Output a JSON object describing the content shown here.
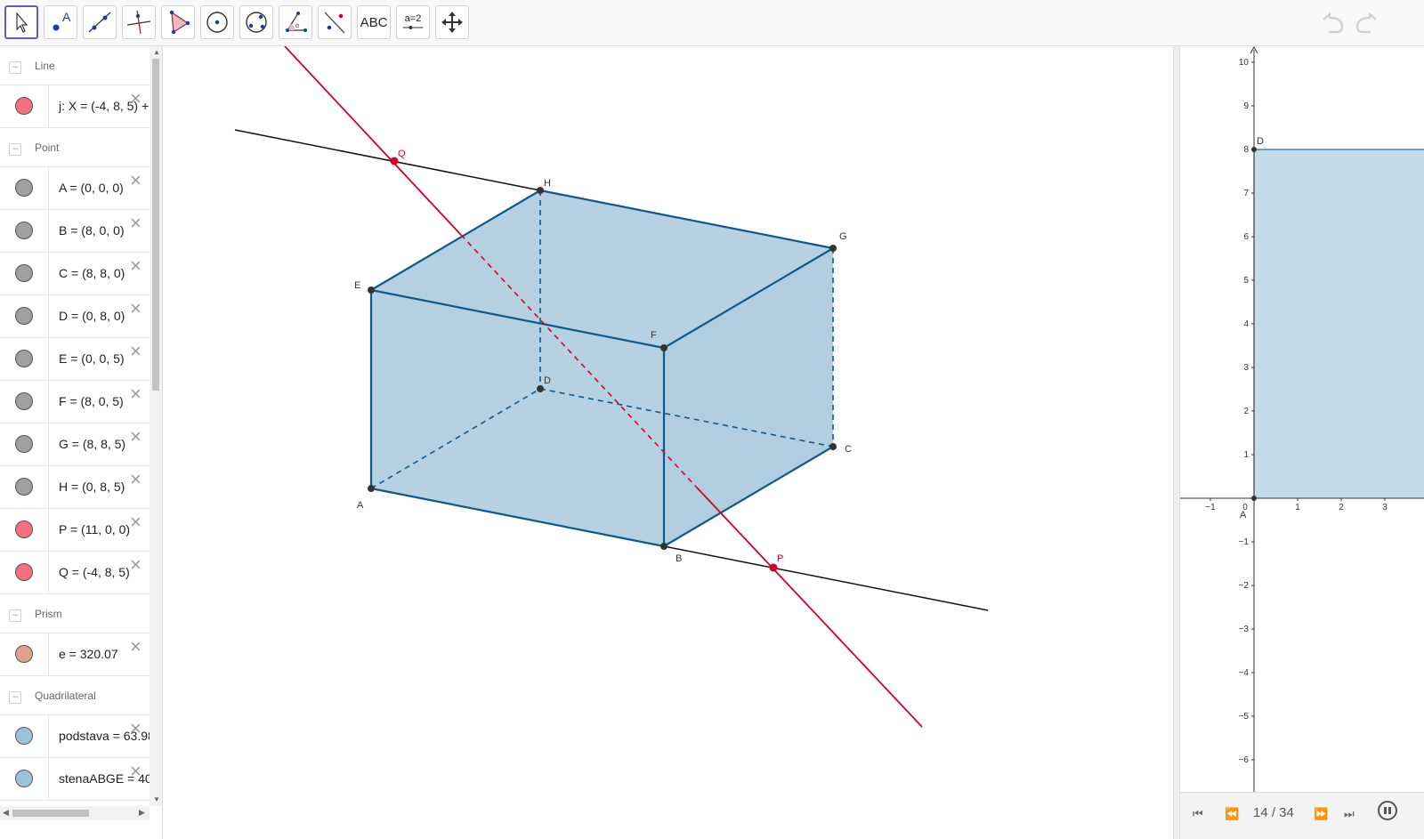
{
  "toolbar": {
    "tools": [
      {
        "name": "move-tool",
        "icon": "cursor-arrow-icon",
        "active": true
      },
      {
        "name": "point-tool",
        "icon": "point-icon"
      },
      {
        "name": "line-tool",
        "icon": "line-icon"
      },
      {
        "name": "perpendicular-tool",
        "icon": "perpendicular-line-icon"
      },
      {
        "name": "polygon-tool",
        "icon": "polygon-icon"
      },
      {
        "name": "circle-tool",
        "icon": "circle-center-icon"
      },
      {
        "name": "conic-tool",
        "icon": "circle-through-points-icon"
      },
      {
        "name": "angle-tool",
        "icon": "angle-icon"
      },
      {
        "name": "reflect-tool",
        "icon": "reflect-icon"
      },
      {
        "name": "text-tool",
        "icon": "text-icon",
        "label": "ABC"
      },
      {
        "name": "slider-tool",
        "icon": "slider-icon",
        "label": "a=2"
      },
      {
        "name": "move-view-tool",
        "icon": "move-graphics-icon"
      }
    ],
    "undo_icon": "undo-icon",
    "redo_icon": "redo-icon"
  },
  "algebra": {
    "groups": [
      {
        "name": "Line",
        "items": [
          {
            "def": "j: X = (-4, 8, 5) +",
            "color": "#f5707f"
          }
        ]
      },
      {
        "name": "Point",
        "items": [
          {
            "def": "A = (0, 0, 0)",
            "color": "#a0a0a0"
          },
          {
            "def": "B = (8, 0, 0)",
            "color": "#a0a0a0"
          },
          {
            "def": "C = (8, 8, 0)",
            "color": "#a0a0a0"
          },
          {
            "def": "D = (0, 8, 0)",
            "color": "#a0a0a0"
          },
          {
            "def": "E = (0, 0, 5)",
            "color": "#a0a0a0"
          },
          {
            "def": "F = (8, 0, 5)",
            "color": "#a0a0a0"
          },
          {
            "def": "G = (8, 8, 5)",
            "color": "#a0a0a0"
          },
          {
            "def": "H = (0, 8, 5)",
            "color": "#a0a0a0"
          },
          {
            "def": "P = (11, 0, 0)",
            "color": "#f5707f"
          },
          {
            "def": "Q = (-4, 8, 5)",
            "color": "#f5707f"
          }
        ]
      },
      {
        "name": "Prism",
        "items": [
          {
            "def": "e = 320.07",
            "color": "#dfa090"
          }
        ]
      },
      {
        "name": "Quadrilateral",
        "items": [
          {
            "def": "podstava = 63.98",
            "color": "#9cc3dc"
          },
          {
            "def": "stenaABGE = 40.",
            "color": "#9cc3dc"
          }
        ]
      }
    ]
  },
  "view3d": {
    "point_labels": [
      "Q",
      "H",
      "G",
      "E",
      "F",
      "D",
      "C",
      "A",
      "B",
      "P"
    ],
    "colors": {
      "prism_fill": "#a9c9dd",
      "prism_edge": "#0d5a8a",
      "line_red": "#d4002a",
      "line_black": "#111111",
      "point": "#333333"
    }
  },
  "view2d": {
    "y_ticks": [
      "10",
      "9",
      "8",
      "7",
      "6",
      "5",
      "4",
      "3",
      "2",
      "1",
      "−1",
      "−2",
      "−3",
      "−4",
      "−5",
      "−6"
    ],
    "x_ticks": [
      "−1",
      "0",
      "1",
      "2",
      "3"
    ],
    "labels": {
      "D": "D",
      "A": "A"
    },
    "fill_color": "#c4dcea"
  },
  "playbar": {
    "counter": "14 / 34",
    "buttons": [
      "first-icon",
      "previous-icon",
      "next-icon",
      "last-icon",
      "pause-icon"
    ]
  }
}
